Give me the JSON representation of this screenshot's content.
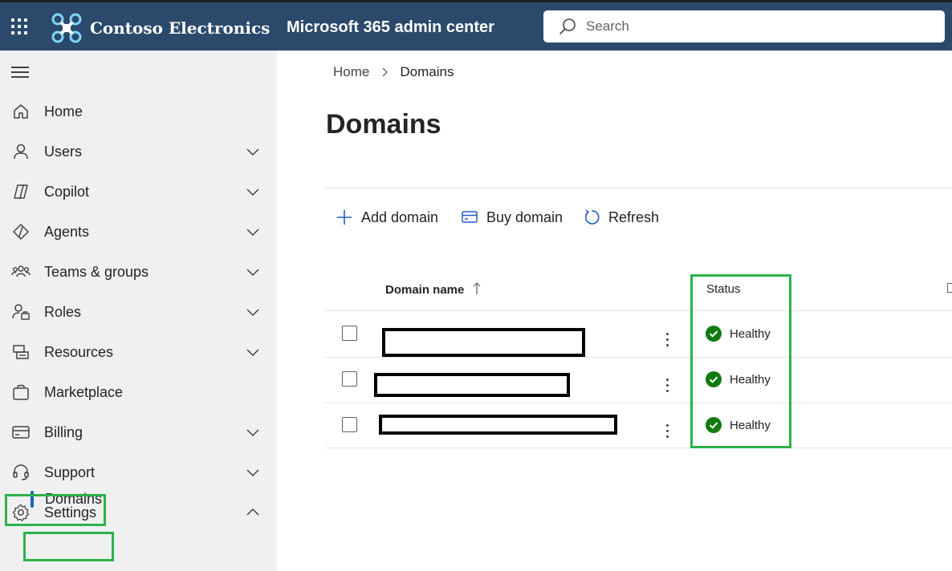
{
  "topbar": {
    "brand_name": "Contoso Electronics",
    "app_title": "Microsoft 365 admin center",
    "search_placeholder": "Search",
    "bg_color": "#2b4a6b"
  },
  "sidebar": {
    "items": [
      {
        "label": "Home",
        "icon": "home-icon",
        "has_chevron": false
      },
      {
        "label": "Users",
        "icon": "user-icon",
        "has_chevron": true
      },
      {
        "label": "Copilot",
        "icon": "copilot-icon",
        "has_chevron": true
      },
      {
        "label": "Agents",
        "icon": "agents-icon",
        "has_chevron": true
      },
      {
        "label": "Teams & groups",
        "icon": "teams-icon",
        "has_chevron": true
      },
      {
        "label": "Roles",
        "icon": "roles-icon",
        "has_chevron": true
      },
      {
        "label": "Resources",
        "icon": "resources-icon",
        "has_chevron": true
      },
      {
        "label": "Marketplace",
        "icon": "shopping-bag-icon",
        "has_chevron": false
      },
      {
        "label": "Billing",
        "icon": "credit-card-icon",
        "has_chevron": true
      },
      {
        "label": "Support",
        "icon": "headset-icon",
        "has_chevron": true
      },
      {
        "label": "Settings",
        "icon": "gear-icon",
        "has_chevron": true,
        "expanded": true
      }
    ],
    "sub_items": [
      {
        "label": "Domains",
        "selected": true
      }
    ]
  },
  "breadcrumb": {
    "home": "Home",
    "current": "Domains"
  },
  "page": {
    "title": "Domains"
  },
  "commands": {
    "add_domain": "Add domain",
    "buy_domain": "Buy domain",
    "refresh": "Refresh"
  },
  "table": {
    "columns": {
      "domain_name": "Domain name",
      "status": "Status"
    },
    "sort": "ascending",
    "rows": [
      {
        "status": "Healthy"
      },
      {
        "status": "Healthy"
      },
      {
        "status": "Healthy"
      }
    ]
  },
  "colors": {
    "highlight": "#2cb24a",
    "healthy": "#107c10",
    "accent": "#1f5fbf"
  }
}
